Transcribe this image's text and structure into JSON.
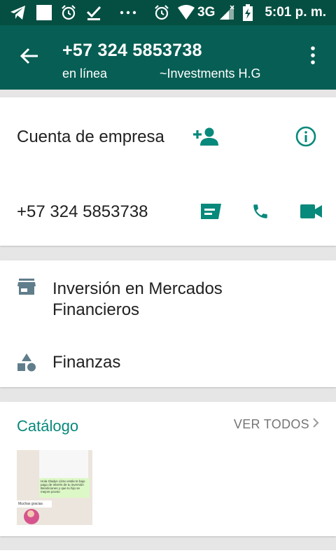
{
  "status_bar": {
    "time": "5:01 p. m.",
    "network": "3G",
    "icons": [
      "telegram-icon",
      "blank-square-icon",
      "alarm-icon",
      "download-check-icon",
      "more-dots-icon",
      "alarm-icon",
      "wifi-icon",
      "signal-icon",
      "battery-charging-icon"
    ]
  },
  "app_bar": {
    "title": "+57 324 5853738",
    "status": "en línea",
    "push_name": "~Investments H.G"
  },
  "contact_card": {
    "business_label": "Cuenta de empresa",
    "phone": "+57 324 5853738"
  },
  "business_info": {
    "category": "Inversión en Mercados Financieros",
    "category_line1": "Inversión en Mercados",
    "category_line2": "Financieros",
    "subcategory": "Finanzas"
  },
  "catalog": {
    "title": "Catálogo",
    "see_all": "VER TODOS",
    "thumb_message": "Hola Gladys cómo estás te bajo pago de Interés de tu inversión Bendiciones y que tu hijo se mejore pronto",
    "thumb_reply": "Muchas gracias"
  },
  "colors": {
    "status_bar": "#054f42",
    "app_bar": "#075e54",
    "accent": "#07897b",
    "icon_gray": "#607d8b"
  }
}
